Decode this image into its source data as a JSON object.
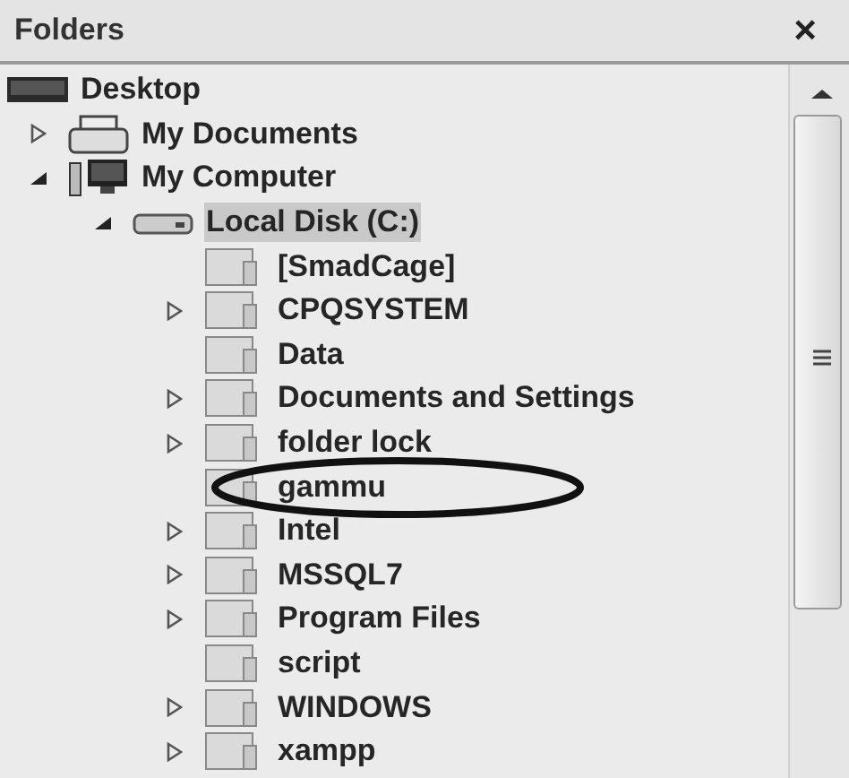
{
  "pane": {
    "title": "Folders",
    "close": "×"
  },
  "tree": [
    {
      "label": "Desktop",
      "kind": "desktop",
      "expandable": false,
      "selected": false
    },
    {
      "label": "My Documents",
      "kind": "documents",
      "expandable": true,
      "expanded": false,
      "selected": false
    },
    {
      "label": "My Computer",
      "kind": "computer",
      "expandable": true,
      "expanded": true,
      "selected": false,
      "children": [
        {
          "label": "Local Disk (C:)",
          "kind": "drive",
          "expandable": true,
          "expanded": true,
          "selected": true,
          "children": [
            {
              "label": "[SmadCage]",
              "kind": "folder",
              "expandable": false,
              "selected": false
            },
            {
              "label": "CPQSYSTEM",
              "kind": "folder",
              "expandable": true,
              "expanded": false,
              "selected": false
            },
            {
              "label": "Data",
              "kind": "folder",
              "expandable": false,
              "selected": false
            },
            {
              "label": "Documents and Settings",
              "kind": "folder",
              "expandable": true,
              "expanded": false,
              "selected": false
            },
            {
              "label": "folder lock",
              "kind": "folder",
              "expandable": true,
              "expanded": false,
              "selected": false
            },
            {
              "label": "gammu",
              "kind": "folder",
              "expandable": false,
              "selected": false,
              "circled": true
            },
            {
              "label": "Intel",
              "kind": "folder",
              "expandable": true,
              "expanded": false,
              "selected": false
            },
            {
              "label": "MSSQL7",
              "kind": "folder",
              "expandable": true,
              "expanded": false,
              "selected": false
            },
            {
              "label": "Program Files",
              "kind": "folder",
              "expandable": true,
              "expanded": false,
              "selected": false
            },
            {
              "label": "script",
              "kind": "folder",
              "expandable": false,
              "selected": false
            },
            {
              "label": "WINDOWS",
              "kind": "folder",
              "expandable": true,
              "expanded": false,
              "selected": false
            },
            {
              "label": "xampp",
              "kind": "folder",
              "expandable": true,
              "expanded": false,
              "selected": false
            }
          ]
        }
      ]
    }
  ]
}
